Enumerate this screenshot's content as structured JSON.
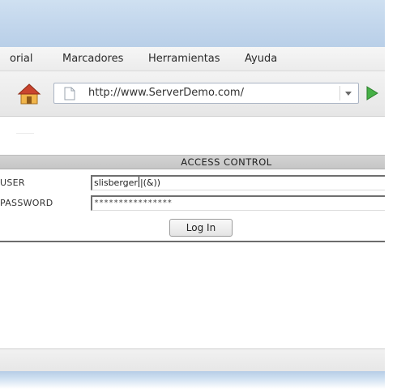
{
  "menu": {
    "items": [
      "orial",
      "Marcadores",
      "Herramientas",
      "Ayuda"
    ]
  },
  "nav": {
    "url": "http://www.ServerDemo.com/",
    "icons": [
      "home-icon",
      "page-icon",
      "dropdown-arrow-icon",
      "go-arrow-icon"
    ]
  },
  "form": {
    "header": "ACCESS CONTROL",
    "user_label": "USER",
    "user_value_before_caret": "slisberger",
    "user_value_after_caret": "|(&))",
    "password_label": "PASSWORD",
    "password_value": "****************",
    "login_label": "Log In"
  },
  "colors": {
    "titlebar": "#c4d8ee",
    "header_bar": "#cccccc",
    "go_arrow": "#3aa63a",
    "home_icon": "#e8a531"
  }
}
